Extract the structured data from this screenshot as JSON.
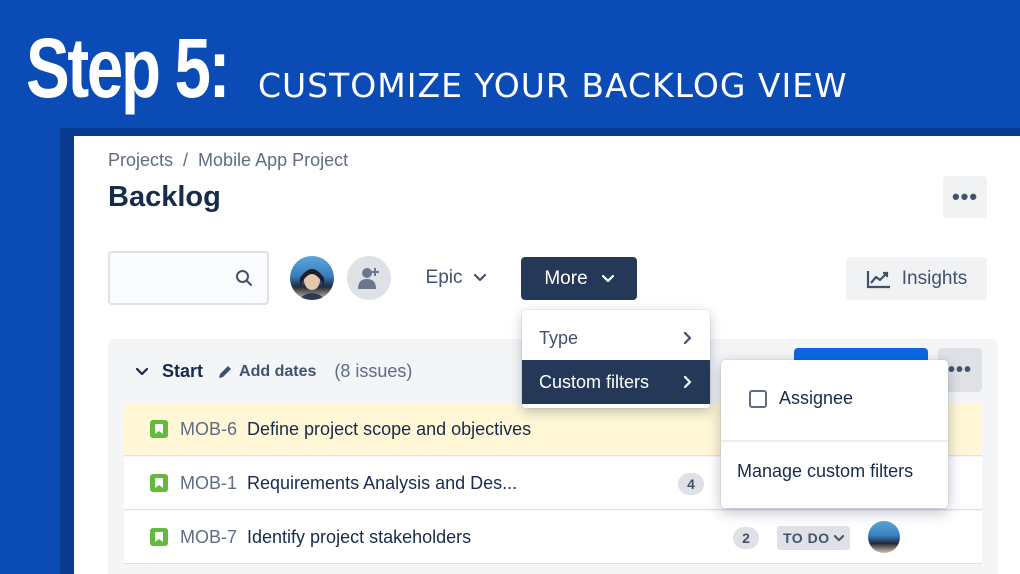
{
  "banner": {
    "step": "Step 5:",
    "caption": "CUSTOMIZE YOUR BACKLOG VIEW"
  },
  "breadcrumb": {
    "items": [
      "Projects",
      "Mobile App Project"
    ],
    "separator": "/"
  },
  "page": {
    "title": "Backlog",
    "more_actions": "•••"
  },
  "toolbar": {
    "search_placeholder": "",
    "epic_label": "Epic",
    "more_label": "More",
    "insights_label": "Insights"
  },
  "more_menu": {
    "items": [
      {
        "label": "Type"
      },
      {
        "label": "Custom filters"
      }
    ],
    "active": "Custom filters"
  },
  "custom_filters_menu": {
    "option_label": "Assignee",
    "option_checked": false,
    "manage_link": "Manage custom filters"
  },
  "sprint": {
    "name": "Start",
    "add_dates": "Add dates",
    "issue_count": "(8 issues)",
    "actions": "•••"
  },
  "issues": [
    {
      "key": "MOB-6",
      "summary": "Define project scope and objectives",
      "points": "",
      "status": "",
      "highlight": true
    },
    {
      "key": "MOB-1",
      "summary": "Requirements Analysis and Des...",
      "points": "4",
      "status": ""
    },
    {
      "key": "MOB-7",
      "summary": "Identify project stakeholders",
      "points": "2",
      "status": "TO DO"
    }
  ],
  "colors": {
    "background": "#0a4bb5",
    "primary_dark": "#253858",
    "highlight_row": "#fff7d6",
    "story_icon": "#63ba3c",
    "brand_blue": "#0c66e4"
  },
  "icons": {
    "search": "search-icon",
    "add_person": "add-person-icon",
    "chevron": "chevron-down-icon",
    "insights": "chart-line-icon",
    "story": "story-icon",
    "pencil": "pencil-icon"
  }
}
